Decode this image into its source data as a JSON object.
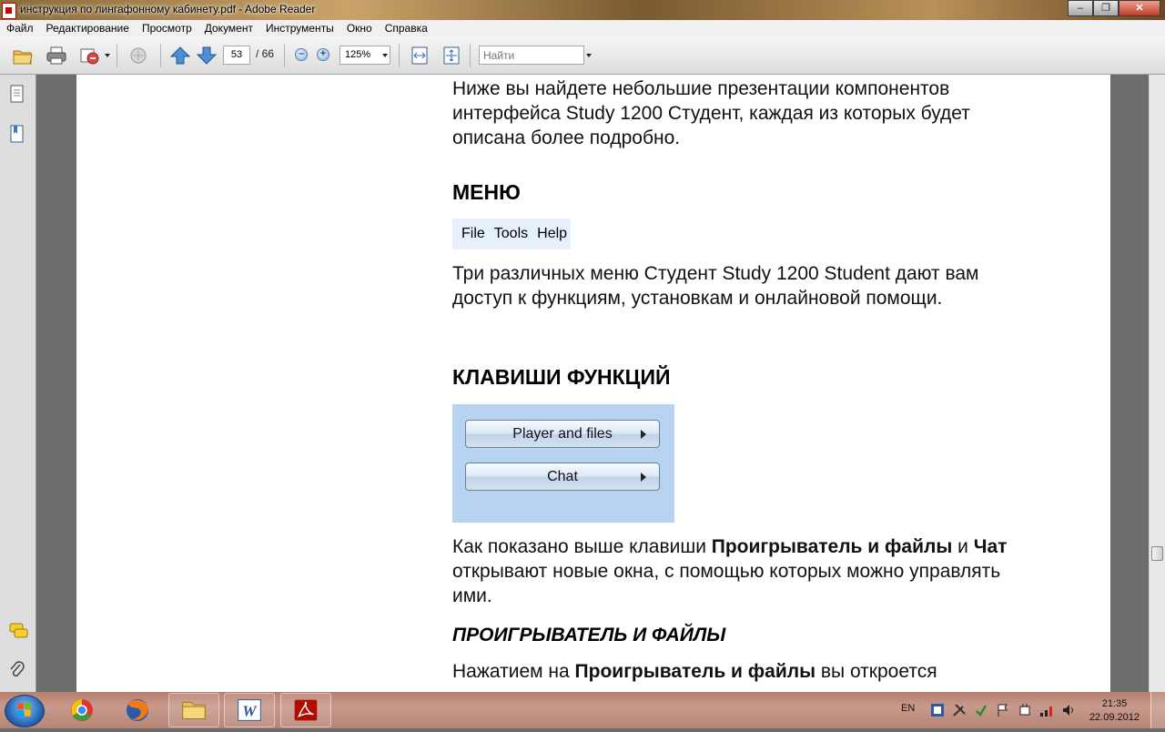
{
  "window": {
    "title": "инструкция по лингафонному кабинету.pdf - Adobe Reader",
    "controls": {
      "minimize": "–",
      "maximize": "❐",
      "close": "✕"
    }
  },
  "menubar": {
    "items": [
      "Файл",
      "Редактирование",
      "Просмотр",
      "Документ",
      "Инструменты",
      "Окно",
      "Справка"
    ]
  },
  "toolbar": {
    "icons": [
      "open-icon",
      "print-icon",
      "email-icon",
      "collaborate-icon",
      "page-up-icon",
      "page-down-icon",
      "zoom-out-icon",
      "zoom-in-icon",
      "fit-page-icon",
      "fit-width-icon"
    ],
    "page_current": "53",
    "page_total": "/ 66",
    "zoom_out": "–",
    "zoom_in": "+",
    "zoom_value": "125%",
    "search_placeholder": "Найти"
  },
  "document": {
    "intro": "Ниже вы найдете небольшие презентации компонентов интерфейса Study 1200 Студент, каждая из которых будет описана более подробно.",
    "heading_menu": "МЕНЮ",
    "menu_figure": [
      "File",
      "Tools",
      "Help"
    ],
    "menu_desc": "Три различных меню Студент Study 1200 Student дают вам доступ к функциям, установкам и онлайновой помощи.",
    "heading_keys": "КЛАВИШИ ФУНКЦИЙ",
    "key_player": "Player and files",
    "key_chat": "Chat",
    "keys_desc": {
      "part1": "Как показано выше клавиши ",
      "bold1": "Проигрыватель и файлы",
      "part2": " и ",
      "bold2": "Чат",
      "part3": " открывают новые окна, с помощью которых можно управлять ими."
    },
    "heading_player": "ПРОИГРЫВАТЕЛЬ И ФАЙЛЫ",
    "player_desc": {
      "part1": "Нажатием на ",
      "bold1": "Проигрыватель и файлы",
      "part2": " вы откроется"
    }
  },
  "taskbar": {
    "apps": [
      "explorer-icon",
      "firefox-icon",
      "folder-icon",
      "word-icon",
      "acrobat-icon"
    ],
    "language": "EN",
    "time": "21:35",
    "date": "22.09.2012"
  },
  "colors": {
    "menu_figure_bg": "#e6f1fb",
    "keys_figure_bg": "#b7d3f1",
    "taskbar": "#c89a8c"
  }
}
